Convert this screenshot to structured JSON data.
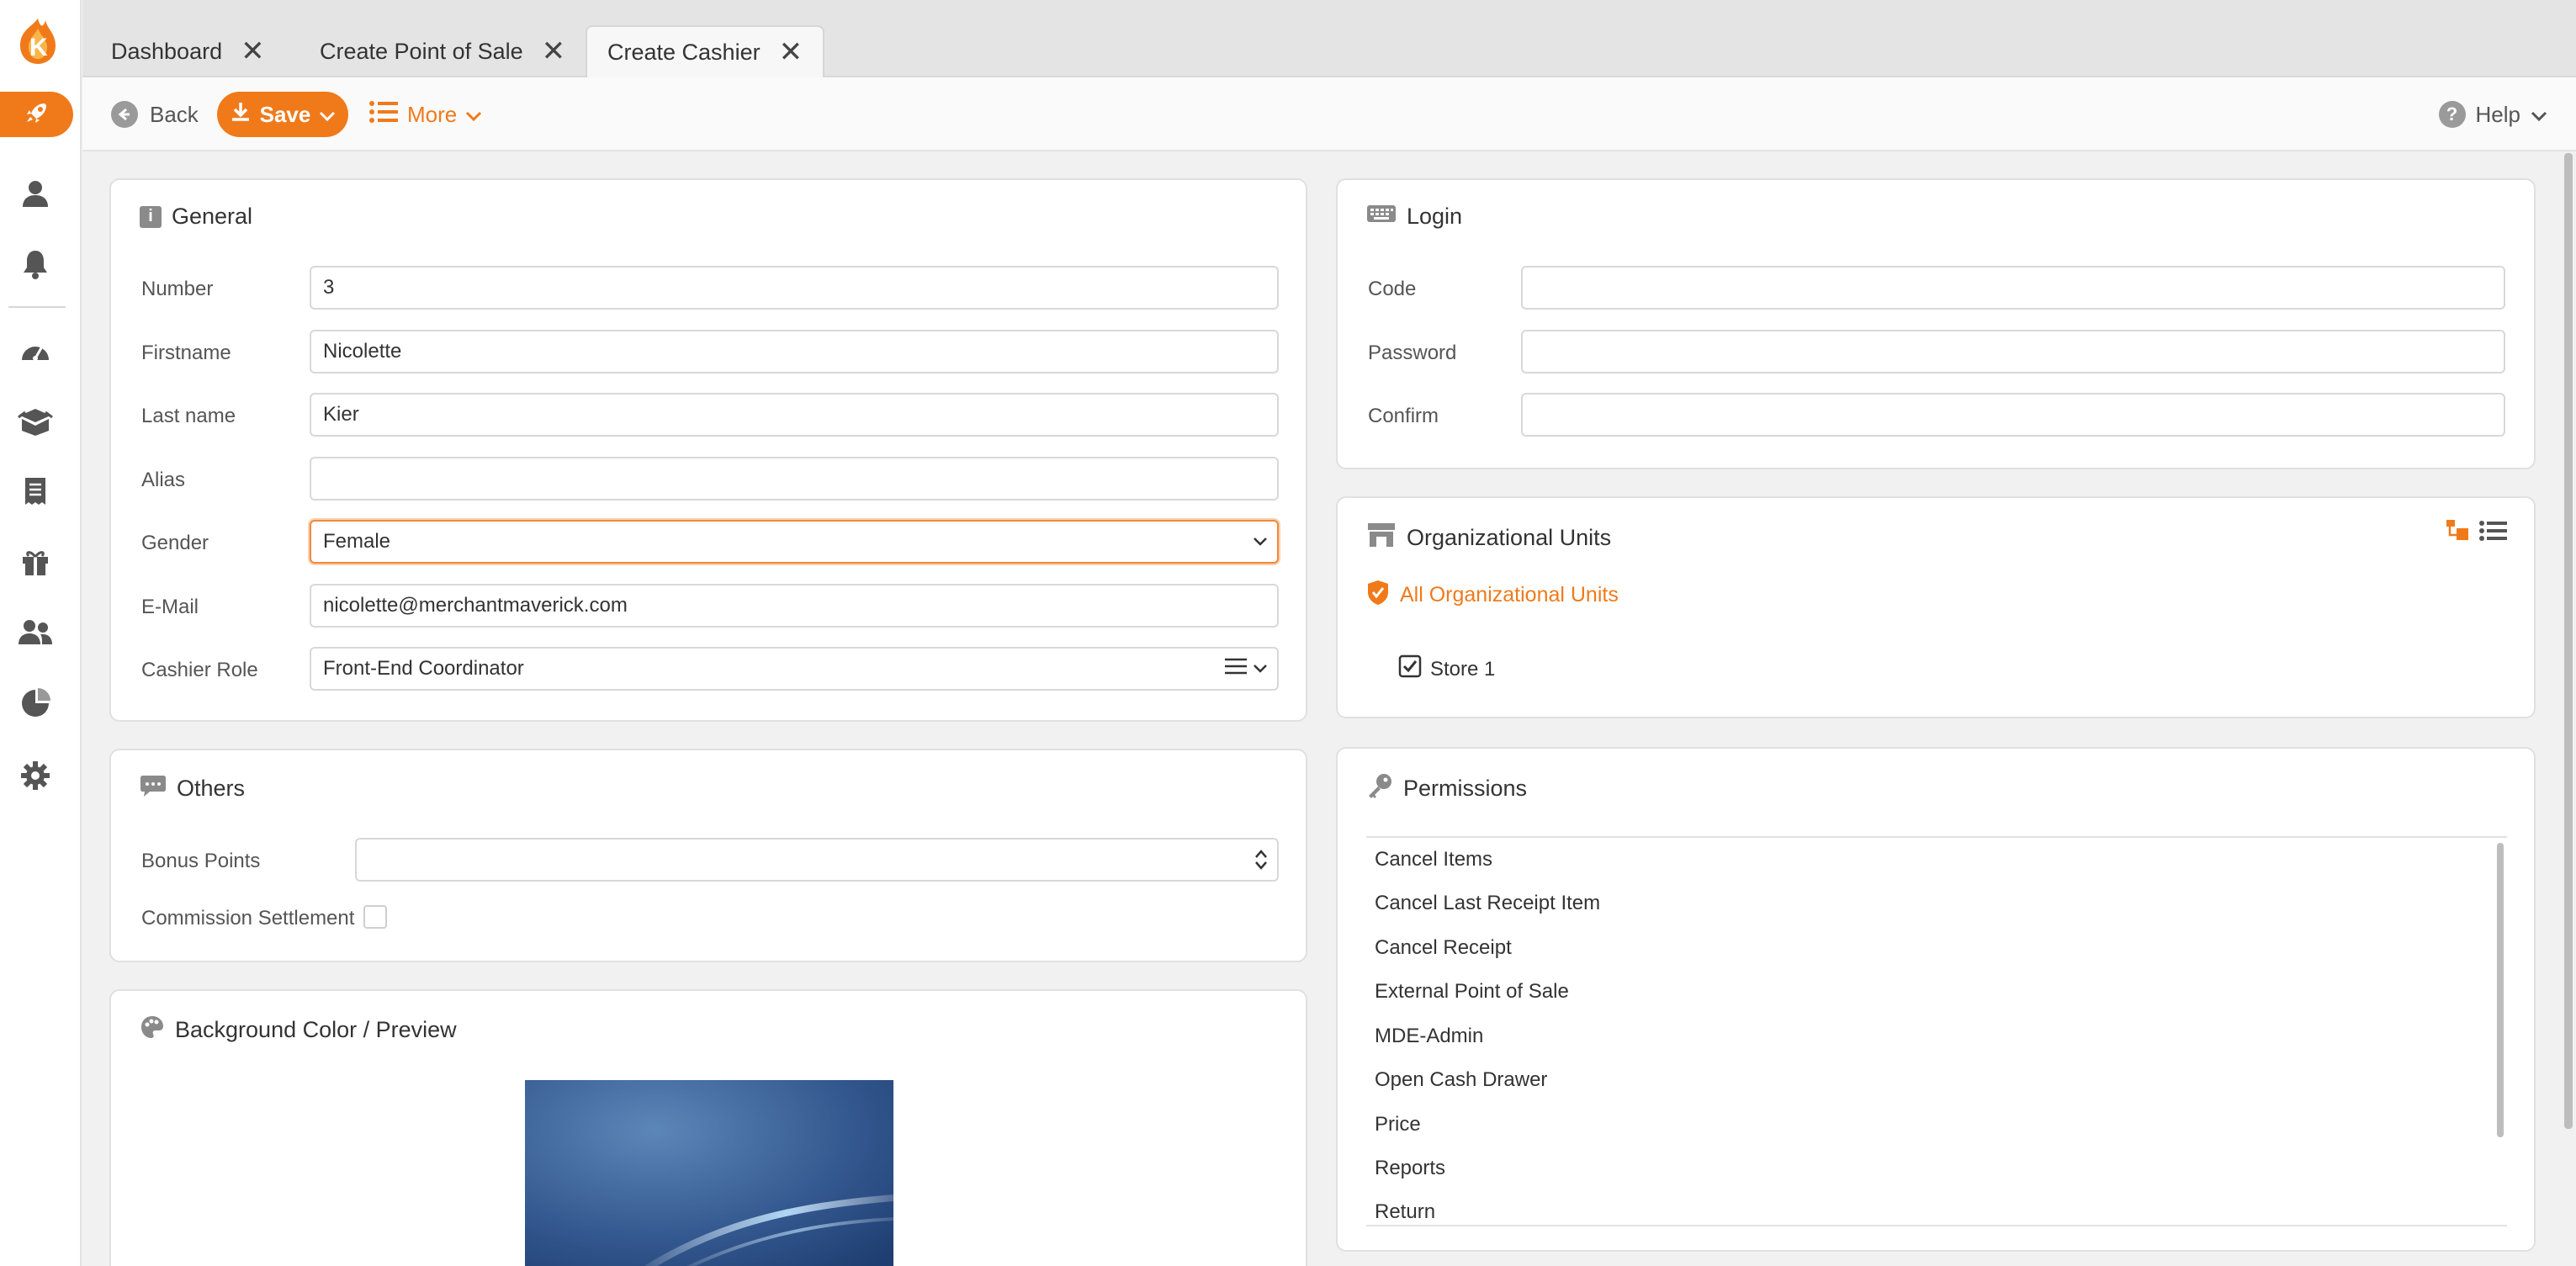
{
  "tabs": [
    {
      "label": "Dashboard"
    },
    {
      "label": "Create Point of Sale"
    },
    {
      "label": "Create Cashier"
    }
  ],
  "toolbar": {
    "back_label": "Back",
    "save_label": "Save",
    "more_label": "More",
    "help_label": "Help"
  },
  "general": {
    "title": "General",
    "fields": {
      "number": {
        "label": "Number",
        "value": "3"
      },
      "firstname": {
        "label": "Firstname",
        "value": "Nicolette"
      },
      "lastname": {
        "label": "Last name",
        "value": "Kier"
      },
      "alias": {
        "label": "Alias",
        "value": ""
      },
      "gender": {
        "label": "Gender",
        "value": "Female"
      },
      "email": {
        "label": "E-Mail",
        "value": "nicolette@merchantmaverick.com"
      },
      "cashier_role": {
        "label": "Cashier Role",
        "value": "Front-End Coordinator"
      }
    }
  },
  "others": {
    "title": "Others",
    "bonus_points_label": "Bonus Points",
    "bonus_points_value": "",
    "commission_label": "Commission Settlement",
    "commission_checked": false
  },
  "background": {
    "title": "Background Color / Preview"
  },
  "login": {
    "title": "Login",
    "code_label": "Code",
    "password_label": "Password",
    "confirm_label": "Confirm"
  },
  "org_units": {
    "title": "Organizational Units",
    "all_label": "All Organizational Units",
    "items": [
      {
        "label": "Store 1",
        "checked": true
      }
    ]
  },
  "permissions": {
    "title": "Permissions",
    "items": [
      "Cancel Items",
      "Cancel Last Receipt Item",
      "Cancel Receipt",
      "External Point of Sale",
      "MDE-Admin",
      "Open Cash Drawer",
      "Price",
      "Reports",
      "Return"
    ]
  },
  "colors": {
    "accent": "#f07a1a",
    "sidebar_icon": "#555555"
  },
  "sidebar_icons": [
    "user-icon",
    "bell-icon",
    "dashboard-gauge-icon",
    "products-box-icon",
    "receipt-icon",
    "gift-icon",
    "users-group-icon",
    "pie-chart-icon",
    "settings-gear-icon"
  ]
}
